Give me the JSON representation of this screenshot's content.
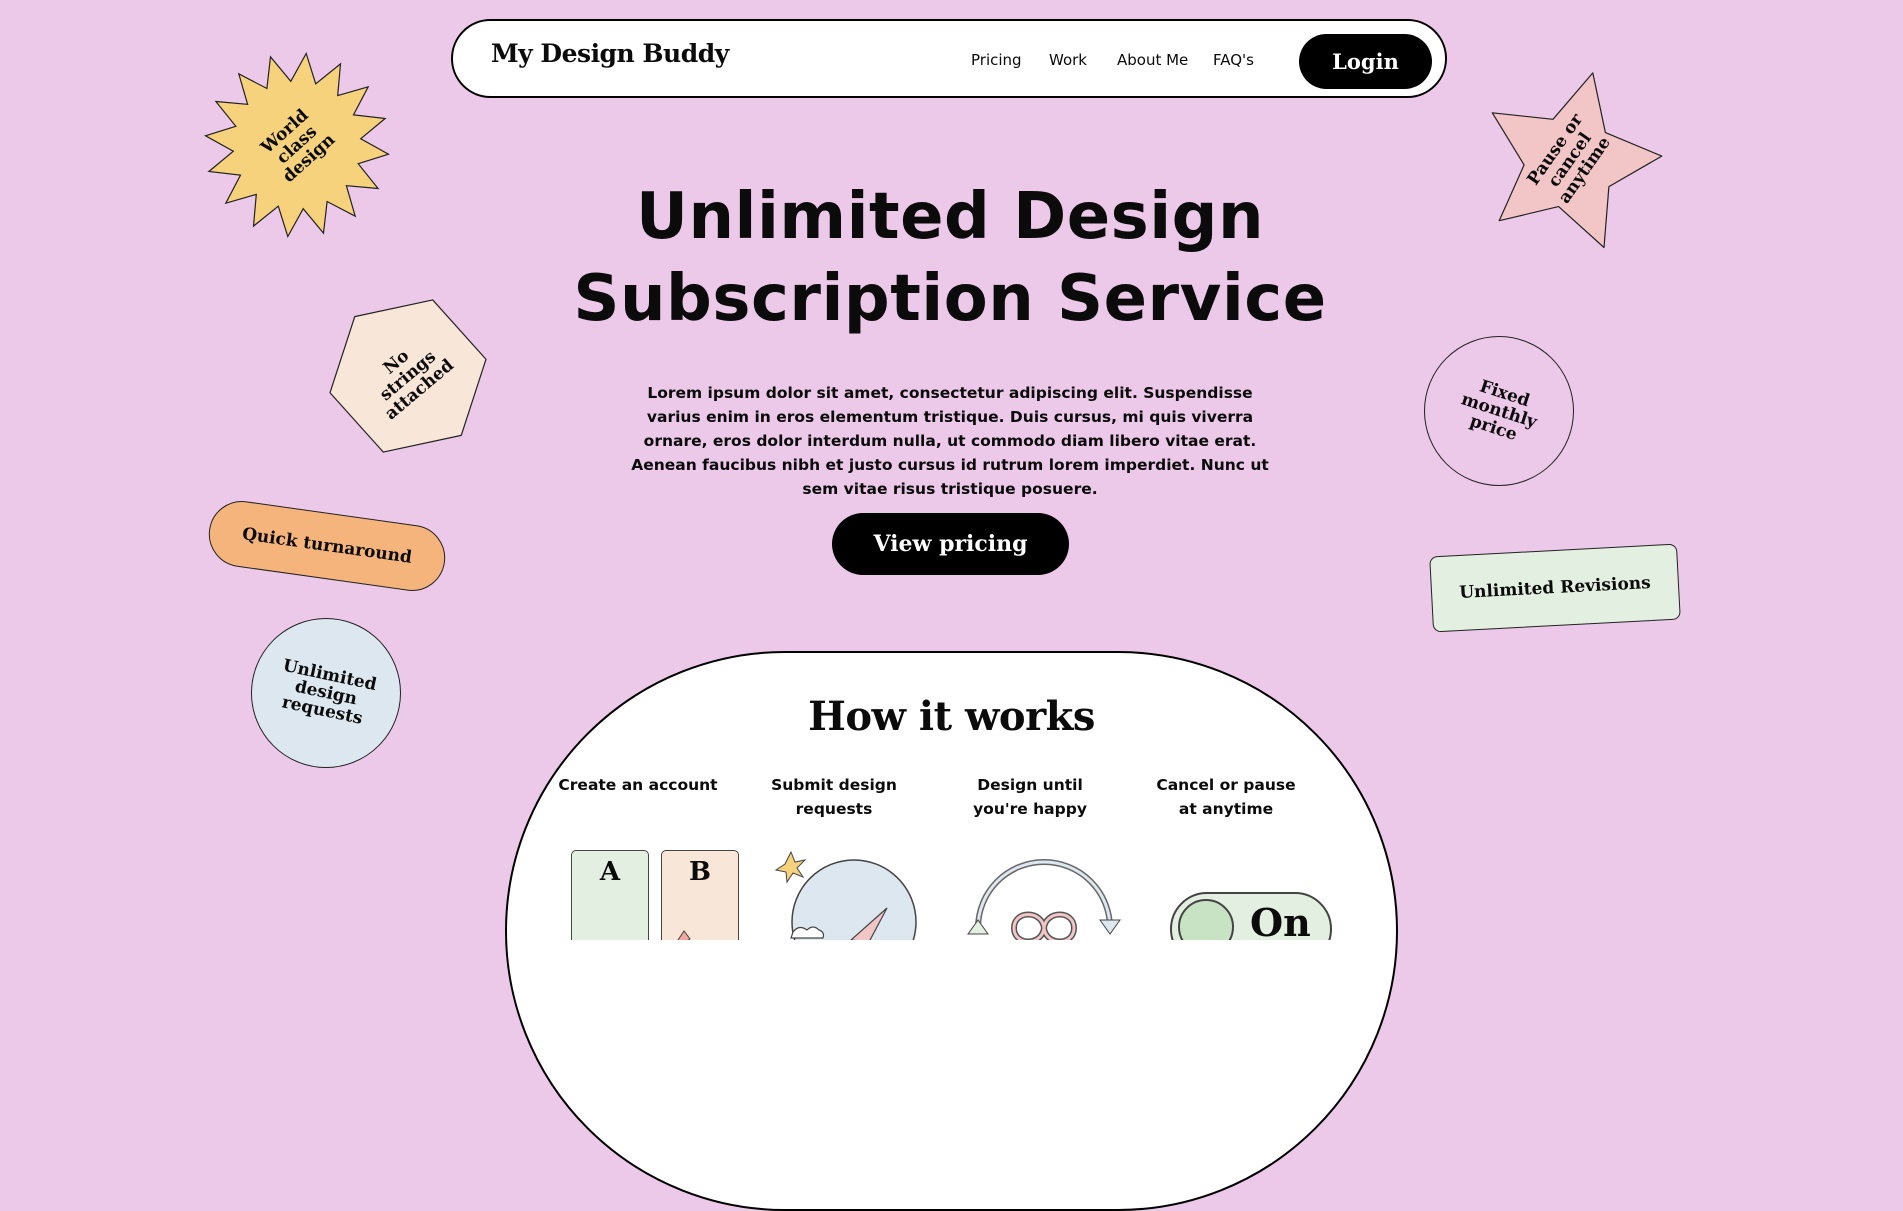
{
  "nav": {
    "brand": "My Design Buddy",
    "links": [
      "Pricing",
      "Work",
      "About Me",
      "FAQ's"
    ],
    "login_label": "Login"
  },
  "hero": {
    "title_line1": "Unlimited Design",
    "title_line2": "Subscription Service",
    "body": "Lorem ipsum dolor sit amet, consectetur adipiscing elit. Suspendisse varius enim in eros elementum tristique. Duis cursus, mi quis viverra ornare, eros dolor interdum nulla, ut commodo diam libero vitae erat. Aenean faucibus nibh et justo cursus id rutrum lorem imperdiet. Nunc ut sem vitae risus tristique posuere.",
    "cta_label": "View pricing"
  },
  "stickers": {
    "world_class": [
      "World",
      "class",
      "design"
    ],
    "no_strings": [
      "No",
      "strings",
      "attached"
    ],
    "quick_turnaround": "Quick turnaround",
    "unlimited_requests": [
      "Unlimited",
      "design",
      "requests"
    ],
    "pause_cancel": [
      "Pause or",
      "cancel",
      "anytime"
    ],
    "fixed_price": [
      "Fixed",
      "monthly",
      "price"
    ],
    "unlimited_revisions": "Unlimited Revisions"
  },
  "how": {
    "title": "How it works",
    "steps": [
      {
        "line1": "Create an account",
        "line2": ""
      },
      {
        "line1": "Submit design",
        "line2": "requests"
      },
      {
        "line1": "Design until",
        "line2": "you're happy"
      },
      {
        "line1": "Cancel or pause",
        "line2": "at anytime"
      }
    ],
    "card_letters": [
      "A",
      "B"
    ],
    "toggle_text": "On"
  },
  "colors": {
    "background": "#ecc9e8",
    "yellow": "#f6d27d",
    "peach_light": "#f8e6d8",
    "orange": "#f5b47c",
    "light_blue": "#dde7f0",
    "pink": "#f2c5c6",
    "mint": "#e3efe1",
    "black": "#000000"
  }
}
